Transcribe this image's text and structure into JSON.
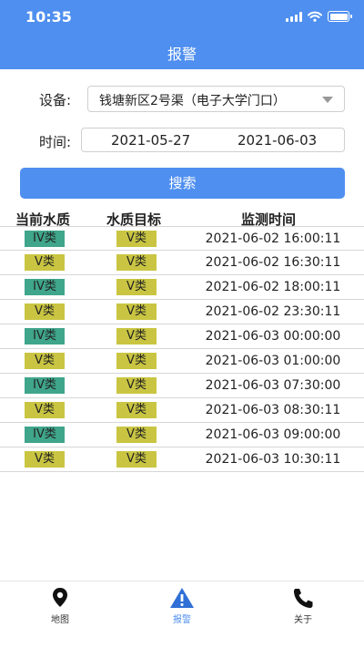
{
  "status_bar": {
    "time": "10:35"
  },
  "header": {
    "title": "报警"
  },
  "form": {
    "device_label": "设备:",
    "device_value": "钱塘新区2号渠（电子大学门口）",
    "time_label": "时间:",
    "start_date": "2021-05-27",
    "end_date": "2021-06-03",
    "search_label": "搜索"
  },
  "table": {
    "headers": [
      "当前水质",
      "水质目标",
      "监测时间"
    ],
    "rows": [
      {
        "current": "IV类",
        "target": "V类",
        "time": "2021-06-02 16:00:11"
      },
      {
        "current": "V类",
        "target": "V类",
        "time": "2021-06-02 16:30:11"
      },
      {
        "current": "IV类",
        "target": "V类",
        "time": "2021-06-02 18:00:11"
      },
      {
        "current": "V类",
        "target": "V类",
        "time": "2021-06-02 23:30:11"
      },
      {
        "current": "IV类",
        "target": "V类",
        "time": "2021-06-03 00:00:00"
      },
      {
        "current": "V类",
        "target": "V类",
        "time": "2021-06-03 01:00:00"
      },
      {
        "current": "IV类",
        "target": "V类",
        "time": "2021-06-03 07:30:00"
      },
      {
        "current": "V类",
        "target": "V类",
        "time": "2021-06-03 08:30:11"
      },
      {
        "current": "IV类",
        "target": "V类",
        "time": "2021-06-03 09:00:00"
      },
      {
        "current": "V类",
        "target": "V类",
        "time": "2021-06-03 10:30:11"
      }
    ]
  },
  "colors": {
    "primary": "#4f8ff0",
    "class_iv": "#3fa58b",
    "class_v": "#c9c542"
  },
  "tabbar": {
    "items": [
      {
        "label": "地图",
        "icon": "map-pin-icon"
      },
      {
        "label": "报警",
        "icon": "alert-triangle-icon"
      },
      {
        "label": "关于",
        "icon": "phone-icon"
      }
    ]
  }
}
